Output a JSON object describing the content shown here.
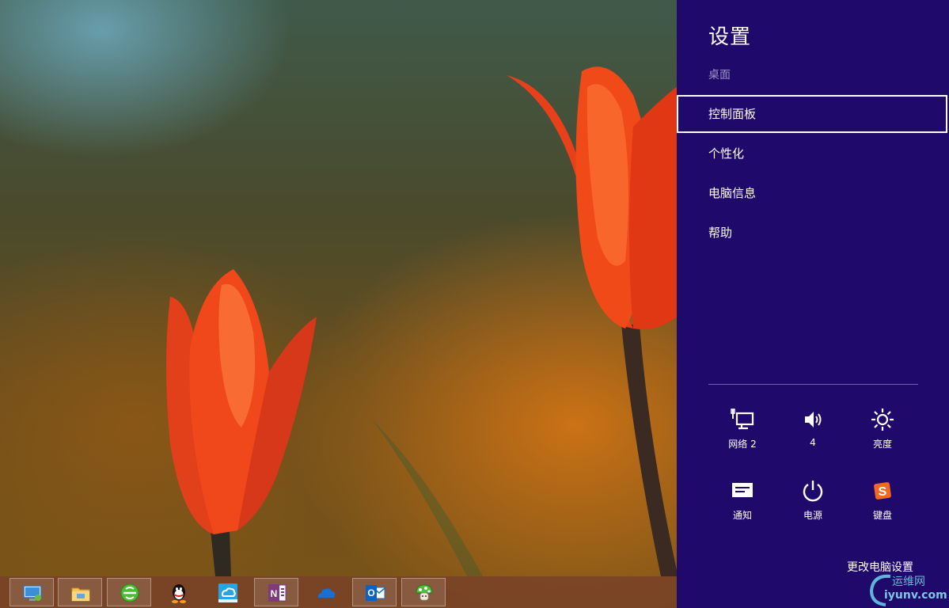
{
  "charm": {
    "title": "设置",
    "subtitle": "桌面",
    "items": [
      {
        "label": "控制面板"
      },
      {
        "label": "个性化"
      },
      {
        "label": "电脑信息"
      },
      {
        "label": "帮助"
      }
    ],
    "quick_settings": [
      {
        "icon": "network-icon",
        "label": "网络 2"
      },
      {
        "icon": "volume-icon",
        "label": "4"
      },
      {
        "icon": "brightness-icon",
        "label": "亮度"
      },
      {
        "icon": "notification-icon",
        "label": "通知"
      },
      {
        "icon": "power-icon",
        "label": "电源"
      },
      {
        "icon": "keyboard-icon",
        "label": "键盘"
      }
    ],
    "change_settings": "更改电脑设置",
    "accent_color": "#1f0a6b"
  },
  "taskbar": {
    "apps": [
      {
        "icon": "remote-desktop-icon"
      },
      {
        "icon": "file-explorer-icon"
      },
      {
        "icon": "browser-icon"
      },
      {
        "icon": "qq-icon"
      },
      {
        "icon": "cloud-sync-icon"
      },
      {
        "icon": "onenote-icon"
      },
      {
        "icon": "onedrive-icon"
      },
      {
        "icon": "outlook-icon"
      },
      {
        "icon": "mushroom-app-icon"
      }
    ]
  },
  "watermark": {
    "line1": "运维网",
    "line2": "iyunv.com"
  }
}
